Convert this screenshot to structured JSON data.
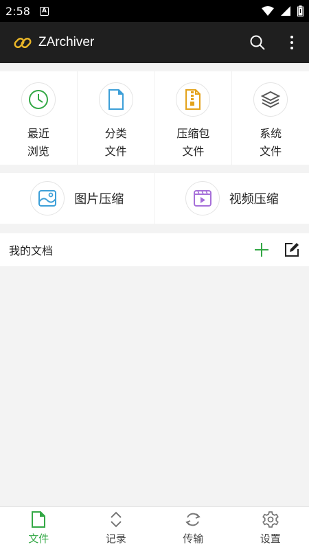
{
  "status_bar": {
    "time": "2:58",
    "notification_letter": "A"
  },
  "app_bar": {
    "title": "ZArchiver"
  },
  "quick_access": [
    {
      "line1": "最近",
      "line2": "浏览",
      "icon": "clock-icon"
    },
    {
      "line1": "分类",
      "line2": "文件",
      "icon": "document-icon"
    },
    {
      "line1": "压缩包",
      "line2": "文件",
      "icon": "archive-file-icon"
    },
    {
      "line1": "系统",
      "line2": "文件",
      "icon": "layers-icon"
    }
  ],
  "compress_tools": [
    {
      "label": "图片压缩",
      "icon": "image-icon"
    },
    {
      "label": "视频压缩",
      "icon": "video-icon"
    }
  ],
  "my_docs": {
    "title": "我的文档"
  },
  "bottom_nav": [
    {
      "label": "文件",
      "active": true
    },
    {
      "label": "记录",
      "active": false
    },
    {
      "label": "传输",
      "active": false
    },
    {
      "label": "设置",
      "active": false
    }
  ],
  "colors": {
    "accent": "#33a845",
    "appbar": "#1f1f1f",
    "statusbar": "#000000",
    "logo": "#e8b528"
  }
}
